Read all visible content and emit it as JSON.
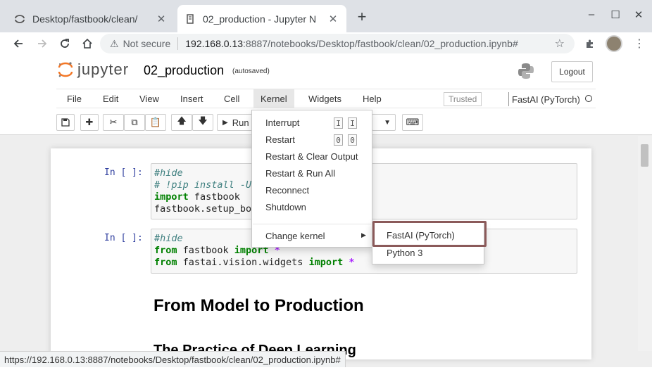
{
  "browser": {
    "tabs": [
      {
        "title": "Desktop/fastbook/clean/",
        "active": false
      },
      {
        "title": "02_production - Jupyter N",
        "active": true
      }
    ],
    "new_tab": "+",
    "security_label": "Not secure",
    "url_host": "192.168.0.13",
    "url_rest": ":8887/notebooks/Desktop/fastbook/clean/02_production.ipynb#",
    "status_url": "https://192.168.0.13:8887/notebooks/Desktop/fastbook/clean/02_production.ipynb#"
  },
  "jupyter": {
    "logo_text": "jupyter",
    "notebook_name": "02_production",
    "save_status": "(autosaved)",
    "logout_label": "Logout",
    "menus": [
      "File",
      "Edit",
      "View",
      "Insert",
      "Cell",
      "Kernel",
      "Widgets",
      "Help"
    ],
    "trusted_label": "Trusted",
    "kernel_name": "FastAI (PyTorch)",
    "run_label": "Run"
  },
  "kernel_menu": {
    "items": [
      "Interrupt",
      "Restart",
      "Restart & Clear Output",
      "Restart & Run All",
      "Reconnect",
      "Shutdown"
    ],
    "shortcuts": {
      "interrupt": [
        "I",
        "I"
      ],
      "restart": [
        "0",
        "0"
      ]
    },
    "change_kernel_label": "Change kernel",
    "kernels": [
      "FastAI (PyTorch)",
      "Python 3"
    ]
  },
  "cells": {
    "prompt": "In [ ]:",
    "cell1": {
      "line1": "#hide",
      "line2": "# !pip install -U",
      "line3_kw": "import",
      "line3_rest": " fastbook",
      "line4": "fastbook.setup_bo"
    },
    "cell2": {
      "line1": "#hide",
      "line2_kw": "from",
      "line2_mod": " fastbook ",
      "line2_kw2": "import",
      "line2_star": " *",
      "line3_kw": "from",
      "line3_mod": " fastai.vision.widgets ",
      "line3_kw2": "import",
      "line3_star": " *"
    },
    "heading1": "From Model to Production",
    "heading2": "The Practice of Deep Learning"
  }
}
